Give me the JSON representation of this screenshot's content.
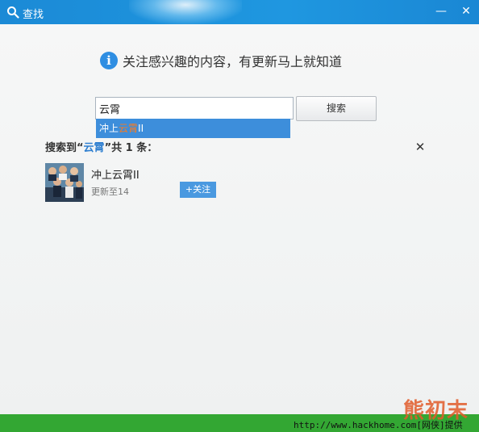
{
  "window": {
    "title": "查找",
    "minimize": "—",
    "close": "✕"
  },
  "info": {
    "icon": "info-icon",
    "text": "关注感兴趣的内容，有更新马上就知道"
  },
  "search": {
    "value": "云霄",
    "button_label": "搜索"
  },
  "suggestion": {
    "prefix": "冲上",
    "highlight": "云霄",
    "suffix": "II"
  },
  "results": {
    "label_prefix": "搜索到“",
    "keyword": "云霄",
    "label_middle": "”共 ",
    "count": "1",
    "label_suffix": " 条：",
    "close": "✕",
    "items": [
      {
        "title": "冲上云霄II",
        "subtitle": "更新至14",
        "action": "+关注"
      }
    ]
  },
  "footer": {
    "url": "http://www.hackhome.com[网侠]提供",
    "watermark": "熊初末"
  },
  "colors": {
    "titlebar": "#1b8ad6",
    "accent": "#3d8edb",
    "highlight": "#ff7a1a",
    "footer": "#33a733"
  }
}
